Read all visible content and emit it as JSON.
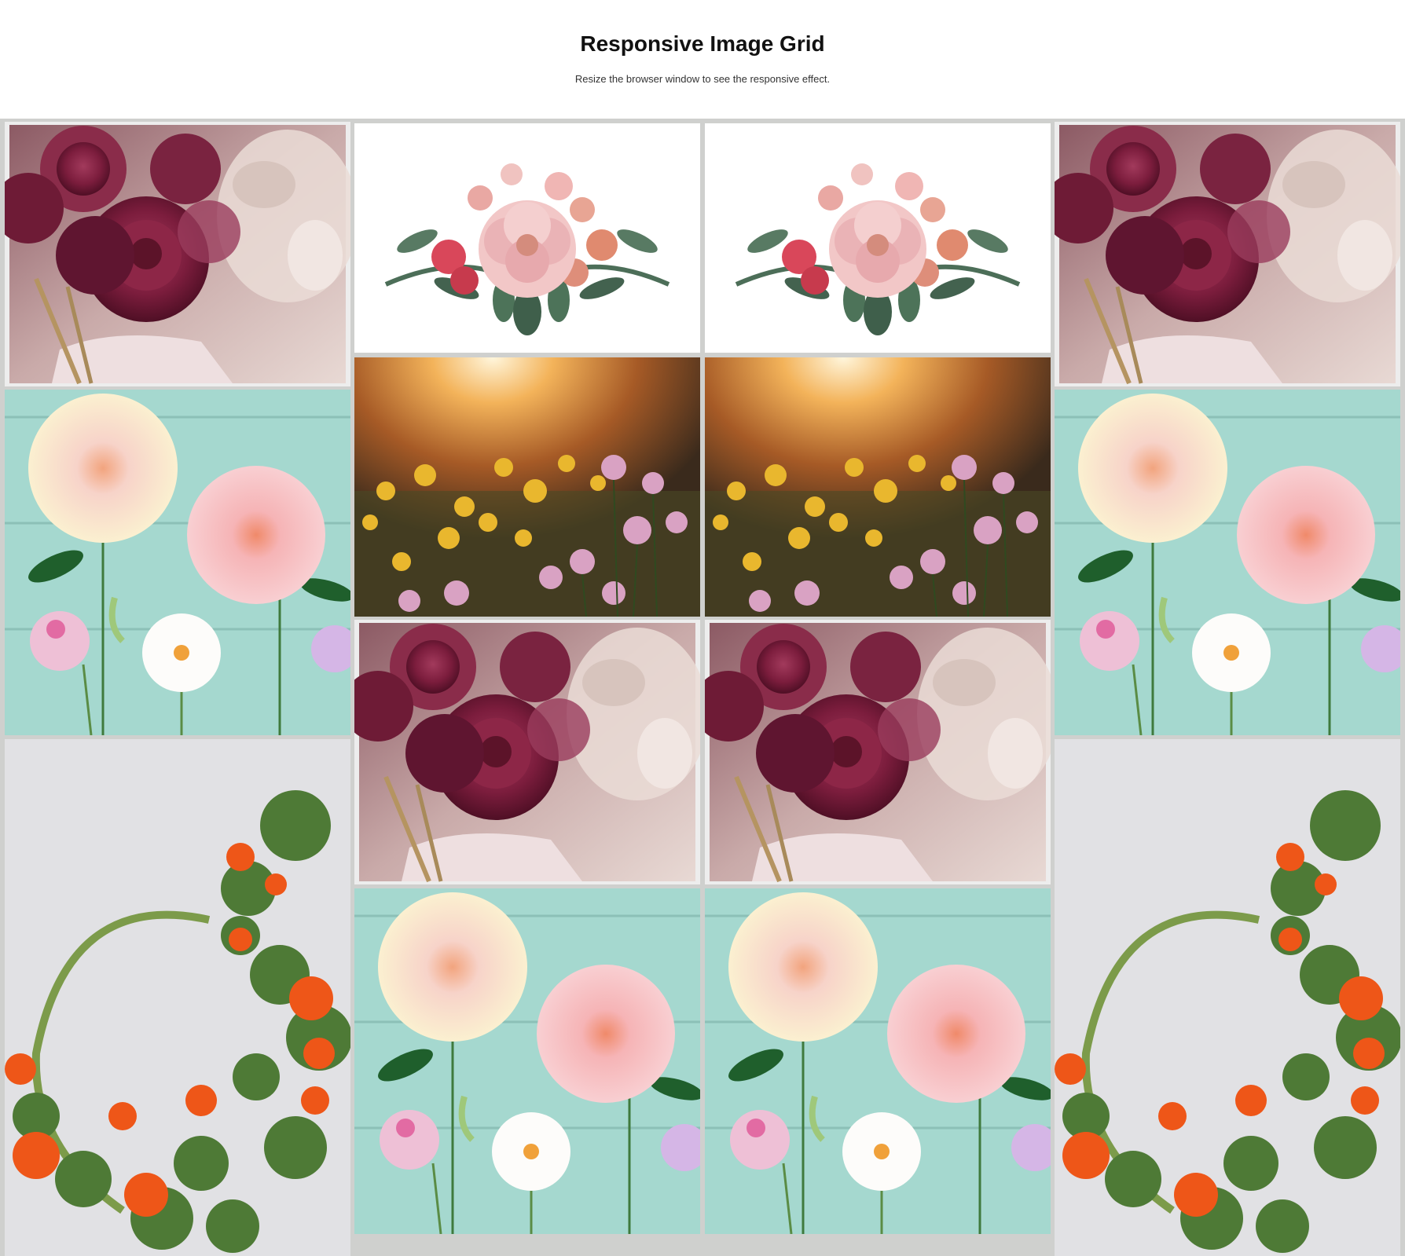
{
  "header": {
    "title": "Responsive Image Grid",
    "subtitle": "Resize the browser window to see the responsive effect."
  },
  "images": {
    "roses": "photo-burgundy-ranunculus-bouquet",
    "bouquet": "illustration-watercolor-floral-bouquet",
    "meadow": "photo-sunset-flower-meadow",
    "dahlias": "photo-paper-dahlias-on-mint-wood",
    "wreath": "photo-nasturtium-wreath-on-linen"
  },
  "colors": {
    "grid_background": "#cfd0ce",
    "page_background": "#ffffff",
    "title": "#111111"
  }
}
